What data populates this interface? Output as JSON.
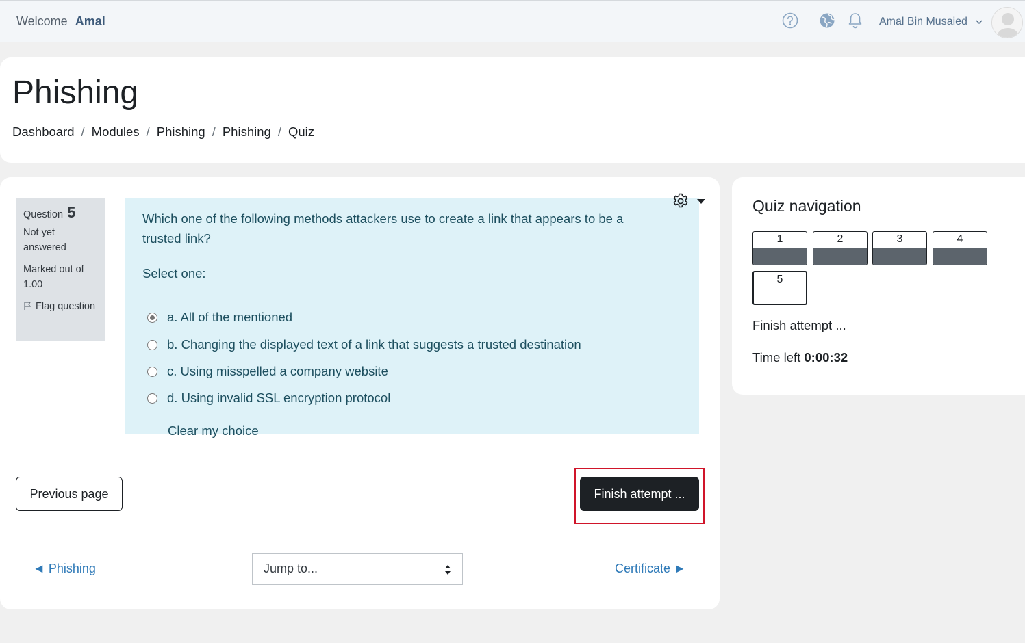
{
  "topbar": {
    "welcome_label": "Welcome",
    "welcome_name": "Amal",
    "user_name": "Amal Bin Musaied",
    "icons": [
      "help-icon",
      "globe-icon",
      "bell-icon",
      "chevron-down-icon",
      "avatar"
    ]
  },
  "header": {
    "title": "Phishing",
    "breadcrumb": [
      "Dashboard",
      "Modules",
      "Phishing",
      "Phishing",
      "Quiz"
    ]
  },
  "question": {
    "label": "Question",
    "number": "5",
    "state": "Not yet answered",
    "mark": "Marked out of 1.00",
    "flag_label": "Flag question",
    "text": "Which one of the following methods attackers use to create a link that appears to be a trusted link?",
    "prompt": "Select one:",
    "options": [
      {
        "label": "a. All of the mentioned",
        "selected": true
      },
      {
        "label": "b. Changing the displayed text of a link that suggests a trusted destination",
        "selected": false
      },
      {
        "label": "c. Using misspelled a company website",
        "selected": false
      },
      {
        "label": "d. Using invalid SSL encryption protocol",
        "selected": false
      }
    ],
    "clear_choice": "Clear my choice"
  },
  "actions": {
    "previous_page": "Previous page",
    "finish_attempt": "Finish attempt ..."
  },
  "activity_nav": {
    "prev_label": "◄ Phishing",
    "jump_placeholder": "Jump to...",
    "next_label": "Certificate ►"
  },
  "quiz_navigation": {
    "title": "Quiz navigation",
    "questions": [
      "1",
      "2",
      "3",
      "4",
      "5"
    ],
    "current": "5",
    "finish_attempt": "Finish attempt ...",
    "time_left_label": "Time left",
    "time_left_value": "0:00:32"
  },
  "colors": {
    "formulation_bg": "#def2f8",
    "primary_button": "#1d2125",
    "link": "#2f7ab8",
    "highlight": "#d0152a"
  }
}
